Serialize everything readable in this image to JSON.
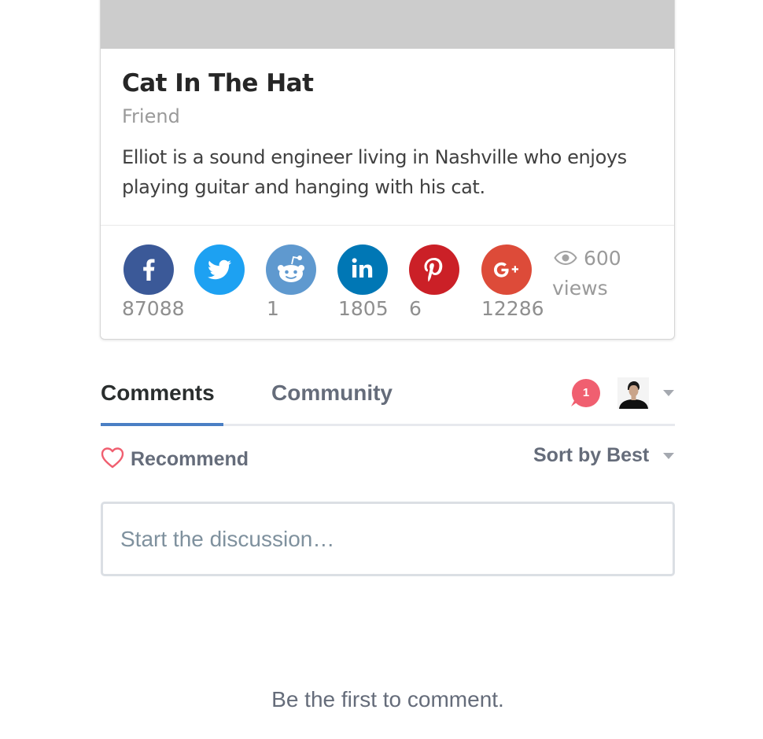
{
  "card": {
    "title": "Cat In The Hat",
    "subtitle": "Friend",
    "description": "Elliot is a sound engineer living in Nashville who enjoys playing guitar and hanging with his cat."
  },
  "share": [
    {
      "network": "facebook",
      "icon": "facebook-icon",
      "color": "#3b5998",
      "count": "87088"
    },
    {
      "network": "twitter",
      "icon": "twitter-icon",
      "color": "#1da1f2",
      "count": ""
    },
    {
      "network": "reddit",
      "icon": "reddit-icon",
      "color": "#5f99cf",
      "count": "1"
    },
    {
      "network": "linkedin",
      "icon": "linkedin-icon",
      "color": "#0077b5",
      "count": "1805"
    },
    {
      "network": "pinterest",
      "icon": "pinterest-icon",
      "color": "#cb2027",
      "count": "6"
    },
    {
      "network": "google-plus",
      "icon": "google-plus-icon",
      "color": "#dd4b39",
      "count": "12286"
    }
  ],
  "views": {
    "icon": "eye-icon",
    "count": "600",
    "label": "views"
  },
  "comments": {
    "tabs": [
      {
        "label": "Comments",
        "active": true
      },
      {
        "label": "Community",
        "active": false
      }
    ],
    "notification_count": "1",
    "recommend_label": "Recommend",
    "sort_label": "Sort by Best",
    "input_placeholder": "Start the discussion…",
    "empty_message": "Be the first to comment."
  },
  "colors": {
    "accent": "#4a7fc4",
    "badge": "#f05f70",
    "heart": "#f05f70",
    "muted_text": "#656c7a"
  }
}
